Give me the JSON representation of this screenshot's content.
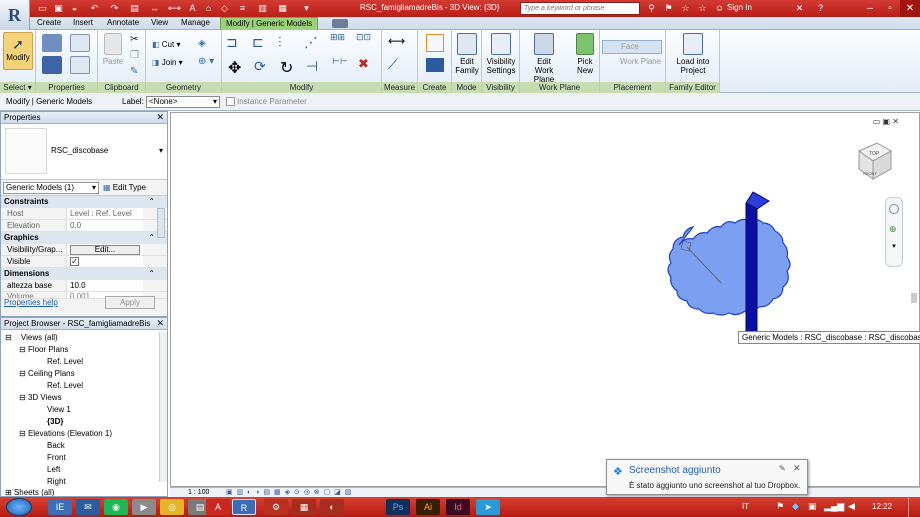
{
  "window": {
    "title": "RSC_famigliamadreBis - 3D View: {3D}",
    "search_placeholder": "Type a keyword or phrase",
    "sign_in": "Sign In",
    "app_letter": "R"
  },
  "tabs": [
    "Create",
    "Insert",
    "Annotate",
    "View",
    "Manage",
    "Modify | Generic Models"
  ],
  "ribbon": {
    "modify": "Modify",
    "select": "Select ▾",
    "properties": "Properties",
    "clipboard": "Clipboard",
    "paste": "Paste",
    "cut": "Cut ▾",
    "join": "Join ▾",
    "geometry": "Geometry",
    "modify_panel": "Modify",
    "measure": "Measure",
    "create": "Create",
    "edit_family_1": "Edit",
    "edit_family_2": "Family",
    "mode": "Mode",
    "visibility_1": "Visibility",
    "visibility_2": "Settings",
    "visibility": "Visibility",
    "edit_wp_1": "Edit",
    "edit_wp_2": "Work Plane",
    "work_plane": "Work Plane",
    "pick_1": "Pick",
    "pick_2": "New",
    "face": "Face",
    "work_plane_btn": "Work Plane",
    "placement": "Placement",
    "load_1": "Load into",
    "load_2": "Project",
    "family_editor": "Family Editor"
  },
  "optbar": {
    "context": "Modify | Generic Models",
    "label": "Label:",
    "label_value": "<None>",
    "instance_param": "Instance Parameter"
  },
  "properties": {
    "title": "Properties",
    "type_name": "RSC_discobase",
    "filter": "Generic Models (1)",
    "edit_type": "Edit Type",
    "groups": {
      "constraints": "Constraints",
      "graphics": "Graphics",
      "dimensions": "Dimensions"
    },
    "rows": {
      "host_k": "Host",
      "host_v": "Level : Ref. Level",
      "elev_k": "Elevation",
      "elev_v": "0.0",
      "vis_k": "Visibility/Grap...",
      "vis_v": "Edit...",
      "visible_k": "Visible",
      "visible_v": "✓",
      "alt_k": "altezza base",
      "alt_v": "10.0",
      "vol_k": "Volume",
      "vol_v": "0.001"
    },
    "help": "Properties help",
    "apply": "Apply"
  },
  "browser": {
    "title": "Project Browser - RSC_famigliamadreBis",
    "items": [
      "Views (all)",
      "Floor Plans",
      "Ref. Level",
      "Ceiling Plans",
      "Ref. Level",
      "3D Views",
      "View 1",
      "{3D}",
      "Elevations (Elevation 1)",
      "Back",
      "Front",
      "Left",
      "Right",
      "Sheets (all)"
    ]
  },
  "viewport": {
    "scale": "1 : 100",
    "viewcube_top": "TOP",
    "viewcube_front": "FRONT",
    "tooltip": "Generic Models : RSC_discobase : RSC_discobase"
  },
  "toast": {
    "title": "Screenshot aggiunto",
    "body": "È stato aggiunto uno screenshot al tuo Dropbox."
  },
  "taskbar": {
    "lang": "IT",
    "time": "12:22",
    "apps": [
      "IE",
      "✉",
      "◉",
      "▶",
      "◎",
      "▤",
      "A",
      "R",
      "⚙",
      "▦",
      "◐",
      "Ps",
      "Ai",
      "Id",
      "➤"
    ]
  },
  "colors": {
    "title_red": "#c12a22",
    "ribbon_green": "#9bd17a",
    "cloud_blue": "#7b9ff1",
    "column_blue": "#0b0fa3"
  }
}
